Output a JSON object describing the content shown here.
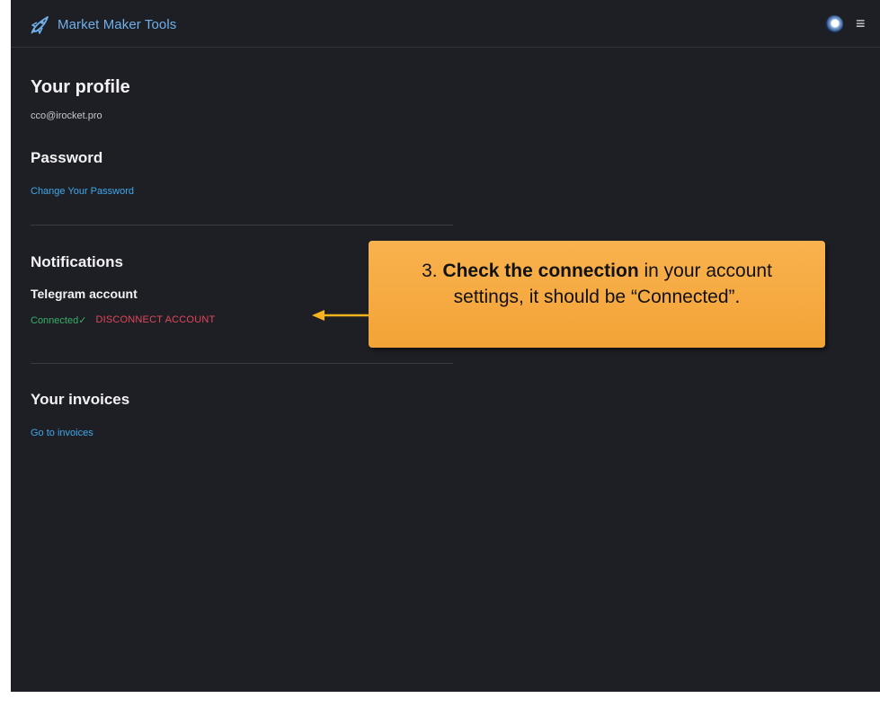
{
  "header": {
    "brand_name": "Market Maker Tools",
    "brand_color": "#6fb0ea",
    "avatar_icon": "user-avatar",
    "menu_icon": "hamburger-menu-icon",
    "menu_glyph": "≡"
  },
  "profile": {
    "title": "Your profile",
    "email": "cco@irocket.pro"
  },
  "password": {
    "title": "Password",
    "change_link": "Change Your Password"
  },
  "notifications": {
    "title": "Notifications",
    "telegram_label": "Telegram account",
    "status_text": "Connected",
    "status_icon": "checkmark-icon",
    "status_glyph": "✓",
    "status_color": "#38b06a",
    "disconnect_label": "DISCONNECT ACCOUNT",
    "disconnect_color": "#e2465b"
  },
  "invoices": {
    "title": "Your invoices",
    "link": "Go to invoices"
  },
  "annotation": {
    "number": "3.",
    "bold": "Check the connection",
    "rest": "in your account settings, it should be “Connected”.",
    "color": "#f5a83c"
  }
}
